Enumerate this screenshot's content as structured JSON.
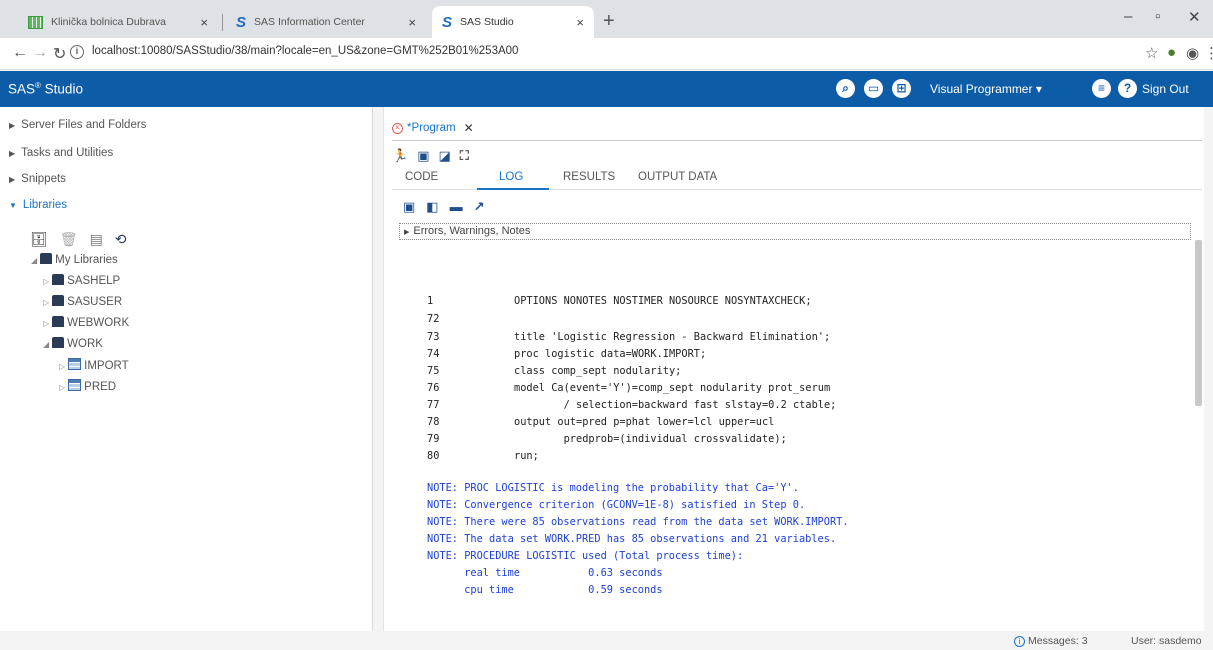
{
  "browser": {
    "tabs": [
      {
        "title": "Klinička bolnica Dubrava",
        "close": "×"
      },
      {
        "title": "SAS Information Center",
        "close": "×"
      },
      {
        "title": "SAS Studio",
        "close": "×"
      }
    ],
    "new_tab": "+",
    "window_controls": {
      "minimize": "–",
      "restore": "▫",
      "close": "✕"
    },
    "url": "localhost:10080/SASStudio/38/main?locale=en_US&zone=GMT%252B01%253A00"
  },
  "app": {
    "title": "SAS",
    "title_sup": "®",
    "title_suffix": " Studio",
    "mode_label": "Visual Programmer",
    "mode_caret": "▾",
    "signout": "Sign Out"
  },
  "sidebar": {
    "sections": [
      {
        "label": "Server Files and Folders",
        "open": false
      },
      {
        "label": "Tasks and Utilities",
        "open": false
      },
      {
        "label": "Snippets",
        "open": false
      },
      {
        "label": "Libraries",
        "open": true
      }
    ],
    "tree": {
      "root": "My Libraries",
      "libs": [
        "SASHELP",
        "SASUSER",
        "WEBWORK",
        "WORK"
      ],
      "work_tables": [
        "IMPORT",
        "PRED"
      ]
    }
  },
  "editor": {
    "program_tab": "*Program",
    "subtabs": [
      "CODE",
      "LOG",
      "RESULTS",
      "OUTPUT DATA"
    ],
    "active_subtab": "LOG",
    "ewn_label": "Errors, Warnings, Notes",
    "log_lines": [
      {
        "num": "1",
        "code": "OPTIONS NONOTES NOSTIMER NOSOURCE NOSYNTAXCHECK;"
      },
      {
        "num": "72",
        "code": ""
      },
      {
        "num": "73",
        "code": "title 'Logistic Regression - Backward Elimination';"
      },
      {
        "num": "74",
        "code": "proc logistic data=WORK.IMPORT;"
      },
      {
        "num": "75",
        "code": "class comp_sept nodularity;"
      },
      {
        "num": "76",
        "code": "model Ca(event='Y')=comp_sept nodularity prot_serum"
      },
      {
        "num": "77",
        "code": "        / selection=backward fast slstay=0.2 ctable;"
      },
      {
        "num": "78",
        "code": "output out=pred p=phat lower=lcl upper=ucl"
      },
      {
        "num": "79",
        "code": "        predprob=(individual crossvalidate);"
      },
      {
        "num": "80",
        "code": "run;"
      }
    ],
    "notes": [
      "NOTE: PROC LOGISTIC is modeling the probability that Ca='Y'.",
      "NOTE: Convergence criterion (GCONV=1E-8) satisfied in Step 0.",
      "NOTE: There were 85 observations read from the data set WORK.IMPORT.",
      "NOTE: The data set WORK.PRED has 85 observations and 21 variables.",
      "NOTE: PROCEDURE LOGISTIC used (Total process time):",
      "      real time           0.63 seconds",
      "      cpu time            0.59 seconds"
    ]
  },
  "status": {
    "messages": "Messages: 3",
    "user": "User: sasdemo"
  }
}
